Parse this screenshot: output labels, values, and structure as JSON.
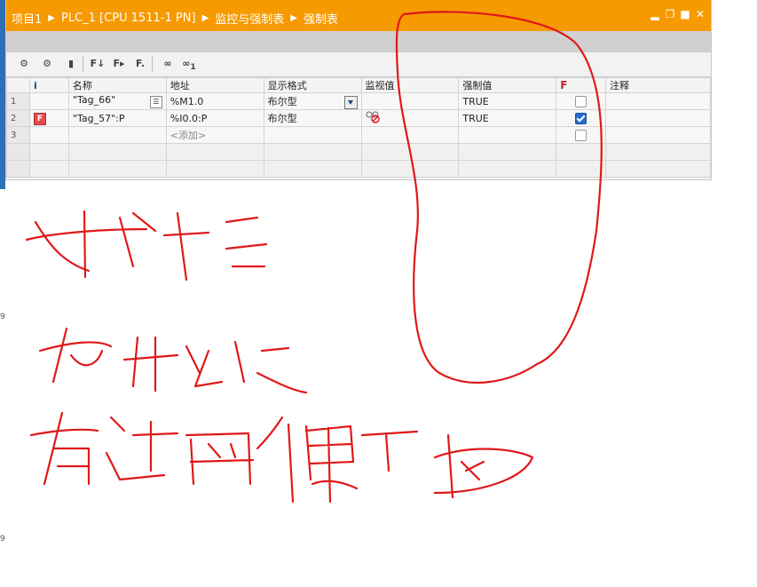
{
  "breadcrumb": [
    "项目1",
    "PLC_1 [CPU 1511-1 PN]",
    "监控与强制表",
    "强制表"
  ],
  "window_controls": [
    "minimize-icon",
    "restore-icon",
    "maximize-icon",
    "close-icon"
  ],
  "toolbar": {
    "buttons": [
      "monitor-all-icon",
      "monitor-once-icon",
      "show-hide-columns-icon",
      "force-icon",
      "stop-force-icon",
      "force-all-icon",
      "glasses-monitor-icon",
      "glasses-monitor-once-icon"
    ],
    "labels": {
      "f1": "F",
      "f2": "F",
      "f3": "F",
      "g2": "1"
    }
  },
  "table": {
    "headers": {
      "info": "i",
      "name": "名称",
      "address": "地址",
      "display_format": "显示格式",
      "monitor_value": "监视值",
      "force_value": "强制值",
      "force": "F",
      "comment": "注释"
    },
    "rows": [
      {
        "num": "1",
        "info_icon": "",
        "name": "\"Tag_66\"",
        "address": "%M1.0",
        "display_format": "布尔型",
        "monitor_value": "",
        "force_value": "TRUE",
        "force_checked": false,
        "comment": ""
      },
      {
        "num": "2",
        "info_icon": "F",
        "name": "\"Tag_57\":P",
        "address": "%I0.0:P",
        "display_format": "布尔型",
        "monitor_value": "",
        "force_value": "TRUE",
        "force_checked": true,
        "comment": ""
      },
      {
        "num": "3",
        "info_icon": "",
        "name": "",
        "address": "<添加>",
        "display_format": "",
        "monitor_value": "",
        "force_value": "",
        "force_checked": false,
        "comment": ""
      }
    ]
  },
  "annotation": {
    "lines": [
      "我监控",
      "为什么没",
      "有这两个界面"
    ],
    "color": "#e01818"
  },
  "colors": {
    "title_bar": "#f79a00",
    "side_strip": "#2e6fb8",
    "checkbox_checked": "#2b6cd0"
  }
}
